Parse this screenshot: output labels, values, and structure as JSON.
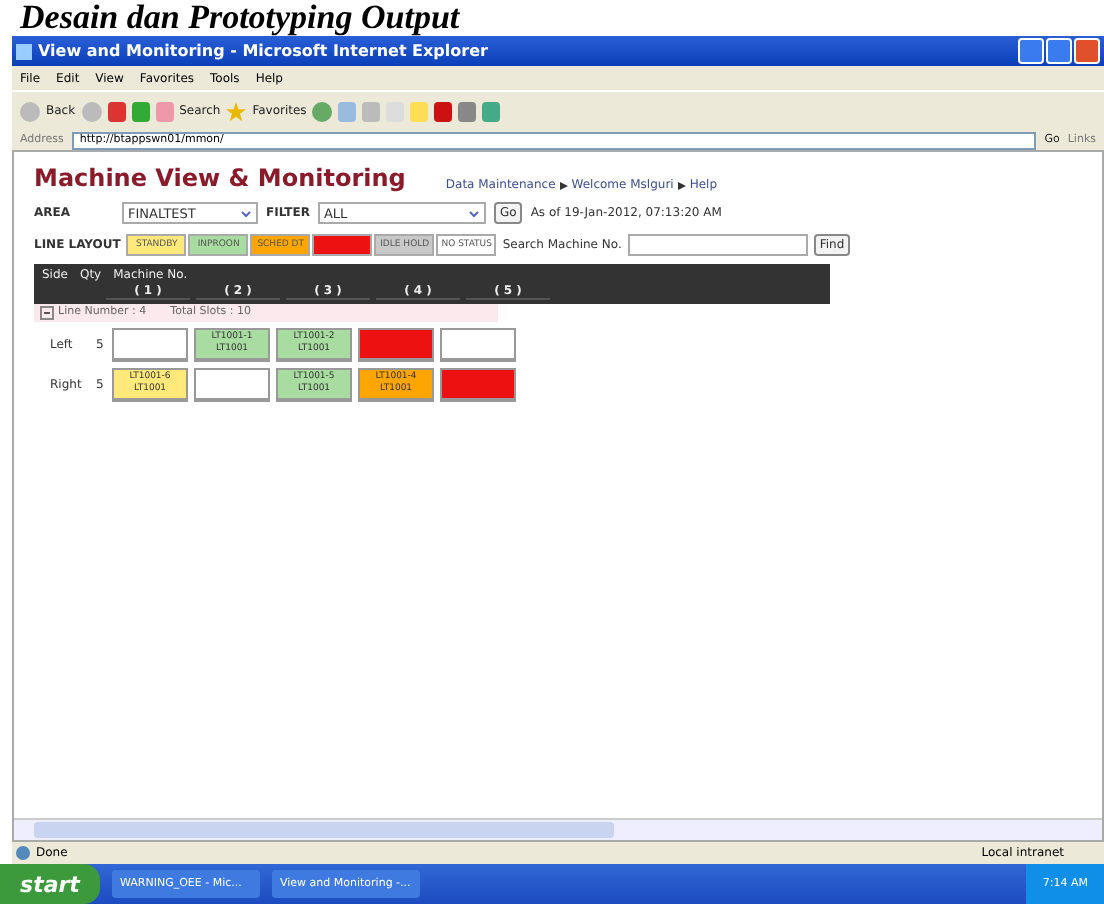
{
  "document_heading": "Desain dan Prototyping Output",
  "window": {
    "title": "View and Monitoring - Microsoft Internet Explorer"
  },
  "menu": [
    "File",
    "Edit",
    "View",
    "Favorites",
    "Tools",
    "Help"
  ],
  "toolbar": {
    "back": "Back",
    "search": "Search",
    "favorites": "Favorites"
  },
  "address": {
    "label": "Address",
    "value": "http://btappswn01/mmon/",
    "go": "Go",
    "links": "Links"
  },
  "page": {
    "title": "Machine View & Monitoring",
    "nav": [
      "Data Maintenance",
      "Welcome Mslguri",
      "Help"
    ],
    "area": {
      "label": "AREA",
      "value": "FINALTEST"
    },
    "filter": {
      "label": "FILTER",
      "value": "ALL"
    },
    "go": "Go",
    "as_of": "As of 19-Jan-2012, 07:13:20 AM",
    "legend_label": "LINE LAYOUT",
    "legend": [
      {
        "label": "STANDBY",
        "color": "#ffe97a"
      },
      {
        "label": "INPROON",
        "color": "#a8dca0"
      },
      {
        "label": "SCHED DT",
        "color": "#ffa500"
      },
      {
        "color": "#ee1111"
      },
      {
        "label": "IDLE HOLD",
        "color": "#c8c8c8"
      },
      {
        "label": "NO STATUS",
        "color": "#ffffff"
      }
    ],
    "search": {
      "label": "Search Machine No.",
      "button": "Find"
    },
    "header": {
      "side_heading": "Side",
      "qty_heading": "Qty",
      "machine_heading": "Machine No."
    },
    "slots": [
      "( 1 )",
      "( 2 )",
      "( 3 )",
      "( 4 )",
      "( 5 )"
    ],
    "line": {
      "number": "Line Number : 4",
      "total": "Total Slots : 10",
      "expanded": true
    },
    "rows": [
      {
        "side": "Left",
        "qty": "5",
        "cells": [
          {
            "color": "#ffffff"
          },
          {
            "color": "#a8dca0",
            "id": "LT1001-1",
            "line": "LT1001"
          },
          {
            "color": "#a8dca0",
            "id": "LT1001-2",
            "line": "LT1001"
          },
          {
            "color": "#ee1111"
          },
          {
            "color": "#ffffff"
          }
        ]
      },
      {
        "side": "Right",
        "qty": "5",
        "cells": [
          {
            "color": "#ffe97a",
            "id": "LT1001-6",
            "line": "LT1001"
          },
          {
            "color": "#ffffff"
          },
          {
            "color": "#a8dca0",
            "id": "LT1001-5",
            "line": "LT1001"
          },
          {
            "color": "#ffa500",
            "id": "LT1001-4",
            "line": "LT1001"
          },
          {
            "color": "#ee1111"
          }
        ]
      }
    ]
  },
  "status_bar": {
    "text": "Done",
    "zone": "Local intranet"
  },
  "taskbar": {
    "start": "start",
    "tasks": [
      "WARNING_OEE - Mic...",
      "View and Monitoring -..."
    ],
    "clock": "7:14 AM"
  }
}
